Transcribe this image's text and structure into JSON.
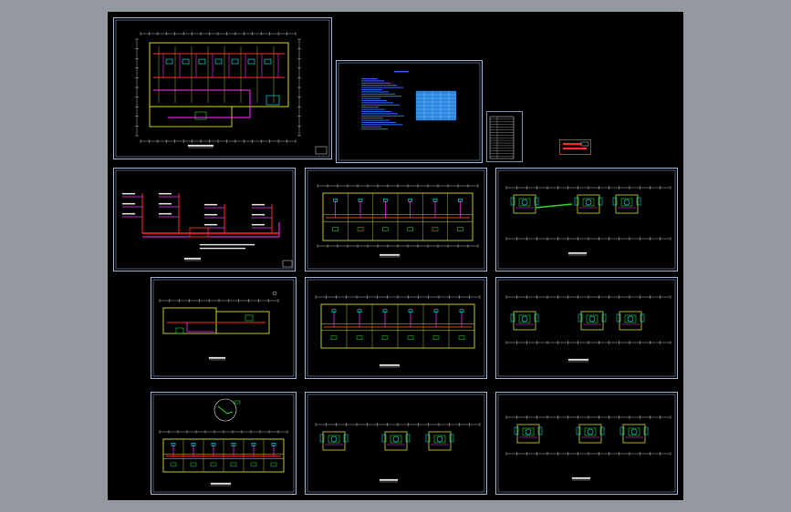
{
  "viewport": {
    "background": "#94999f",
    "canvas_background": "#000000"
  },
  "colors": {
    "frame": "#9fb8e0",
    "wall": "#d8dc2c",
    "dim": "#e6e6e6",
    "pipe_red": "#ff2a2a",
    "pipe_magenta": "#ff33ff",
    "pipe_cyan": "#19f5f5",
    "pipe_green": "#26e026",
    "pipe_blue": "#3a64ff",
    "note_blue": "#2f6dff",
    "table_fill": "#2a86e0"
  },
  "drawing_set": {
    "sheets": [
      {
        "id": "s1",
        "kind": "floor-plan",
        "name": "ground-floor-plan-sheet"
      },
      {
        "id": "s2",
        "kind": "design-notes",
        "name": "design-notes-sheet"
      },
      {
        "id": "s3",
        "kind": "legend-table",
        "name": "legend-table-sheet"
      },
      {
        "id": "s4",
        "kind": "title-stamp",
        "name": "title-stamp"
      },
      {
        "id": "s5",
        "kind": "system-diagram",
        "name": "system-diagram-sheet"
      },
      {
        "id": "s6",
        "kind": "floor-plan",
        "name": "floor-plan-sheet-2"
      },
      {
        "id": "s7",
        "kind": "unit-plan",
        "name": "unit-plan-sheet-1"
      },
      {
        "id": "s8",
        "kind": "floor-plan",
        "name": "floor-plan-sheet-3"
      },
      {
        "id": "s9",
        "kind": "floor-plan",
        "name": "floor-plan-sheet-4"
      },
      {
        "id": "s10",
        "kind": "unit-plan",
        "name": "unit-plan-sheet-2"
      },
      {
        "id": "s11",
        "kind": "floor-plan",
        "name": "floor-plan-sheet-5"
      },
      {
        "id": "s12",
        "kind": "unit-plan",
        "name": "unit-plan-sheet-3"
      },
      {
        "id": "s13",
        "kind": "unit-plan",
        "name": "unit-plan-sheet-4"
      }
    ]
  }
}
